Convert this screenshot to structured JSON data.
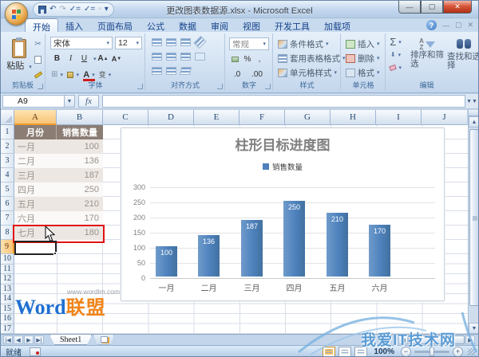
{
  "window": {
    "title": "更改图表数据源.xlsx - Microsoft Excel"
  },
  "tabs": {
    "items": [
      "开始",
      "插入",
      "页面布局",
      "公式",
      "数据",
      "审阅",
      "视图",
      "开发工具",
      "加载项"
    ],
    "active": "开始"
  },
  "ribbon": {
    "clipboard": {
      "paste": "粘贴",
      "label": "剪贴板"
    },
    "font": {
      "name": "宋体",
      "size": "12",
      "bold": "B",
      "italic": "I",
      "underline": "U",
      "grow": "A",
      "shrink": "A",
      "color_letter": "A",
      "phonetic": "变",
      "label": "字体"
    },
    "alignment": {
      "label": "对齐方式"
    },
    "number": {
      "format": "常规",
      "percent": "%",
      "comma": ",",
      "dec_inc": ".0",
      "dec_dec": ".00",
      "label": "数字"
    },
    "styles": {
      "conditional": "条件格式",
      "format_table": "套用表格格式",
      "cell_styles": "单元格样式",
      "label": "样式"
    },
    "cells": {
      "insert": "插入",
      "delete": "删除",
      "format": "格式",
      "label": "单元格"
    },
    "editing": {
      "autosum": "Σ",
      "sort_a": "A",
      "sort_z": "Z",
      "sort": "排序和筛选",
      "find": "查找和选择",
      "label": "编辑"
    }
  },
  "formula_bar": {
    "name_box": "A9",
    "fx": "fx"
  },
  "sheet": {
    "columns": [
      "A",
      "B",
      "C",
      "D",
      "E",
      "F",
      "G",
      "H",
      "I",
      "J"
    ],
    "rows": [
      "1",
      "2",
      "3",
      "4",
      "5",
      "6",
      "7",
      "8",
      "9",
      "10",
      "11",
      "12",
      "13",
      "14",
      "15",
      "16",
      "17"
    ]
  },
  "table": {
    "headers": [
      "月份",
      "销售数量"
    ],
    "rows": [
      {
        "month": "一月",
        "value": "100"
      },
      {
        "month": "二月",
        "value": "136"
      },
      {
        "month": "三月",
        "value": "187"
      },
      {
        "month": "四月",
        "value": "250"
      },
      {
        "month": "五月",
        "value": "210"
      },
      {
        "month": "六月",
        "value": "170"
      },
      {
        "month": "七月",
        "value": "180"
      }
    ]
  },
  "chart_data": {
    "type": "bar",
    "title": "柱形目标进度图",
    "legend": [
      "销售数量"
    ],
    "legend_position": "top",
    "categories": [
      "一月",
      "二月",
      "三月",
      "四月",
      "五月",
      "六月"
    ],
    "values": [
      100,
      136,
      187,
      250,
      210,
      170
    ],
    "yticks": [
      300,
      250,
      200,
      150,
      100,
      50,
      0
    ],
    "ylim": [
      0,
      300
    ],
    "grid": true,
    "bar_color": "#4e81bd",
    "xlabel": "",
    "ylabel": ""
  },
  "watermark": {
    "url": "www.wordlm.com",
    "word": "Word",
    "cn": "联盟",
    "corner": "我爱IT技术网"
  },
  "sheet_tabs": {
    "active": "Sheet1"
  },
  "status": {
    "ready": "就绪",
    "zoom": "100%"
  },
  "colors": {
    "bar": "#4e81bd",
    "table_header_bg": "#8b7d74",
    "selection_red": "#e01210",
    "header_highlight": "#f9c477"
  }
}
